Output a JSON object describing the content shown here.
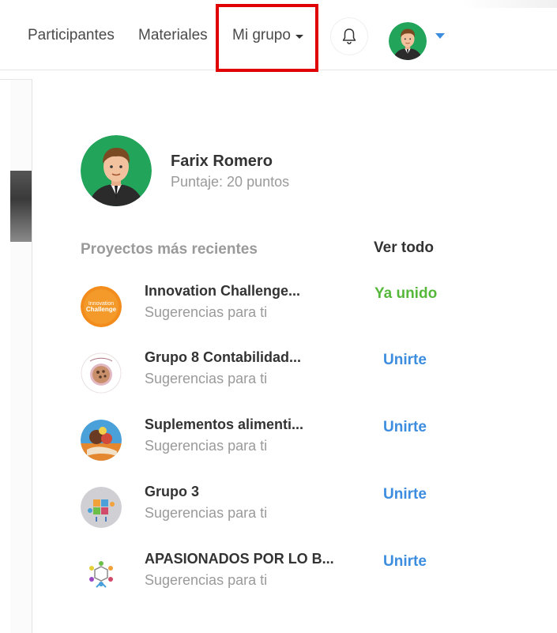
{
  "nav": {
    "items": [
      "Participantes",
      "Materiales",
      "Mi grupo"
    ]
  },
  "profile": {
    "name": "Farix Romero",
    "score": "Puntaje: 20 puntos"
  },
  "projects": {
    "section_title": "Proyectos más recientes",
    "view_all": "Ver todo",
    "items": [
      {
        "title": "Innovation Challenge...",
        "subtitle": "Sugerencias para ti",
        "action": "Ya unido"
      },
      {
        "title": "Grupo 8 Contabilidad...",
        "subtitle": "Sugerencias para ti",
        "action": "Unirte"
      },
      {
        "title": "Suplementos alimenti...",
        "subtitle": "Sugerencias para ti",
        "action": "Unirte"
      },
      {
        "title": "Grupo 3",
        "subtitle": "Sugerencias para ti",
        "action": "Unirte"
      },
      {
        "title": "APASIONADOS POR LO B...",
        "subtitle": "Sugerencias para ti",
        "action": "Unirte"
      }
    ]
  },
  "badges": {
    "innovation_logo_lines": [
      "Innovation",
      "Challenge"
    ]
  },
  "colors": {
    "joined": "#56b83a",
    "join": "#3c8ddf",
    "highlight": "#e00000",
    "avatar_bg": "#22a55a"
  }
}
